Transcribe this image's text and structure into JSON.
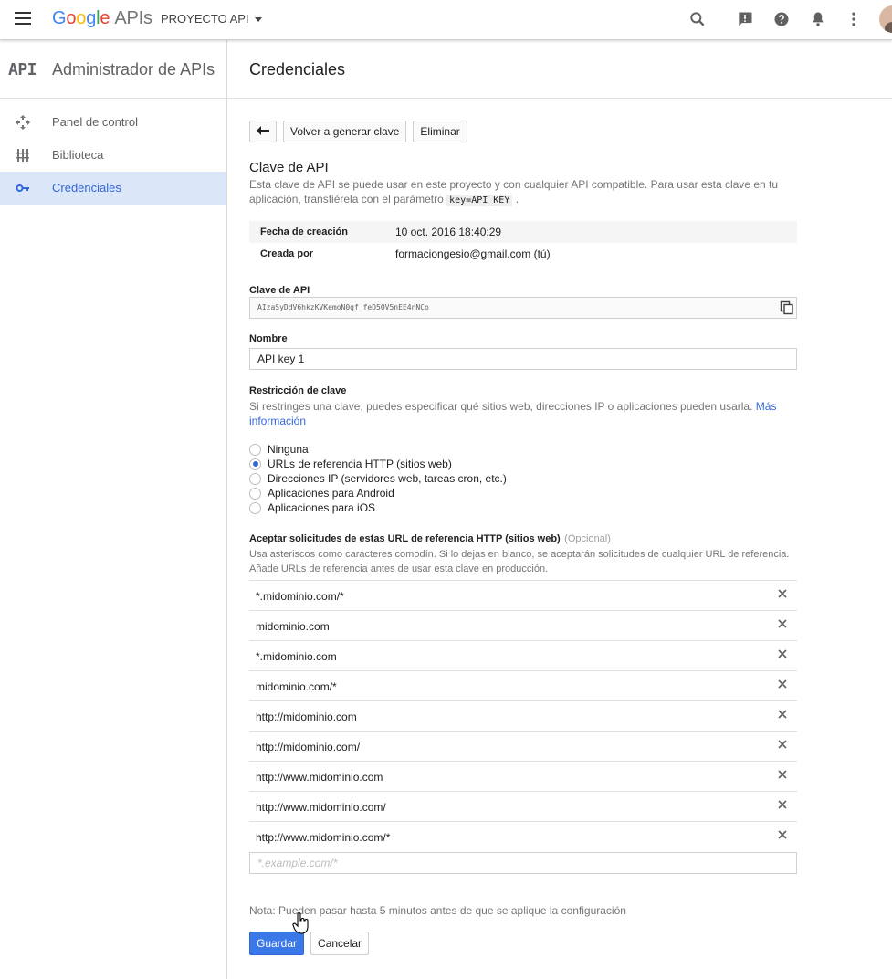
{
  "header": {
    "logo_letters": [
      "G",
      "o",
      "o",
      "g",
      "l",
      "e"
    ],
    "logo_suffix": "APIs",
    "project": "PROYECTO API",
    "icons": [
      "search-icon",
      "feedback-icon",
      "help-icon",
      "notifications-icon",
      "more-vert-icon",
      "account-avatar"
    ]
  },
  "sidebar": {
    "badge": "API",
    "title": "Administrador de APIs",
    "items": [
      {
        "label": "Panel de control",
        "icon": "dashboard-icon"
      },
      {
        "label": "Biblioteca",
        "icon": "library-icon"
      },
      {
        "label": "Credenciales",
        "icon": "key-icon",
        "active": true
      }
    ]
  },
  "main": {
    "title": "Credenciales",
    "toolbar": {
      "back_icon": "back-arrow-icon",
      "regenerate_label": "Volver a generar clave",
      "delete_label": "Eliminar"
    },
    "section_title": "Clave de API",
    "desc_before": "Esta clave de API se puede usar en este proyecto y con cualquier API compatible. Para usar esta clave en tu aplicación, transfiérela con el parámetro",
    "desc_code": "key=API_KEY",
    "desc_after": ".",
    "info": [
      {
        "key": "Fecha de creación",
        "value": "10 oct. 2016 18:40:29"
      },
      {
        "key": "Creada por",
        "value": "formaciongesio@gmail.com (tú)"
      }
    ],
    "api_key_label": "Clave de API",
    "api_key_value": "AIzaSyDdV6hkzKVKemoN0gf_feD5OV5nEE4nNCo",
    "name_label": "Nombre",
    "name_value": "API key 1",
    "restriction_label": "Restricción de clave",
    "restriction_desc": "Si restringes una clave, puedes especificar qué sitios web, direcciones IP o aplicaciones pueden usarla.",
    "restriction_link": "Más información",
    "radios": [
      {
        "label": "Ninguna",
        "selected": false
      },
      {
        "label": "URLs de referencia HTTP (sitios web)",
        "selected": true
      },
      {
        "label": "Direcciones IP (servidores web, tareas cron, etc.)",
        "selected": false
      },
      {
        "label": "Aplicaciones para Android",
        "selected": false
      },
      {
        "label": "Aplicaciones para iOS",
        "selected": false
      }
    ],
    "referrers_label": "Aceptar solicitudes de estas URL de referencia HTTP (sitios web)",
    "referrers_optional": "(Opcional)",
    "referrers_help_1": "Usa asteriscos como caracteres comodín. Si lo dejas en blanco, se aceptarán solicitudes de cualquier URL de referencia.",
    "referrers_help_2": "Añade URLs de referencia antes de usar esta clave en producción.",
    "referrers": [
      "*.midominio.com/*",
      "midominio.com",
      "*.midominio.com",
      "midominio.com/*",
      "http://midominio.com",
      "http://midominio.com/",
      "http://www.midominio.com",
      "http://www.midominio.com/",
      "http://www.midominio.com/*"
    ],
    "new_referrer_placeholder": "*.example.com/*",
    "note": "Nota: Pueden pasar hasta 5 minutos antes de que se aplique la configuración",
    "save_label": "Guardar",
    "cancel_label": "Cancelar"
  },
  "colors": {
    "accent": "#3367d6",
    "primary_button": "#3b78e7",
    "active_nav_bg": "#dbe7f8"
  }
}
